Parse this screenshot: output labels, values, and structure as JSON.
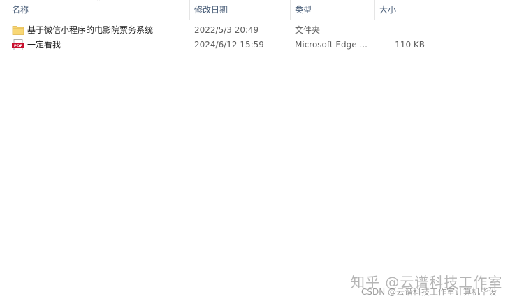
{
  "columns": {
    "name": "名称",
    "modified": "修改日期",
    "type": "类型",
    "size": "大小"
  },
  "files": [
    {
      "name": "基于微信小程序的电影院票务系统",
      "modified": "2022/5/3 20:49",
      "type": "文件夹",
      "size": "",
      "icon": "folder-icon"
    },
    {
      "name": "一定看我",
      "modified": "2024/6/12 15:59",
      "type": "Microsoft Edge ...",
      "size": "110 KB",
      "icon": "pdf-icon",
      "icon_text": "PDF"
    }
  ],
  "watermark": {
    "primary": "知乎 @云谱科技工作室",
    "secondary": "CSDN @云谱科技工作室计算机毕设"
  },
  "colors": {
    "folder": "#f8d775",
    "pdf": "#c8102e",
    "header_text": "#4c607a"
  }
}
